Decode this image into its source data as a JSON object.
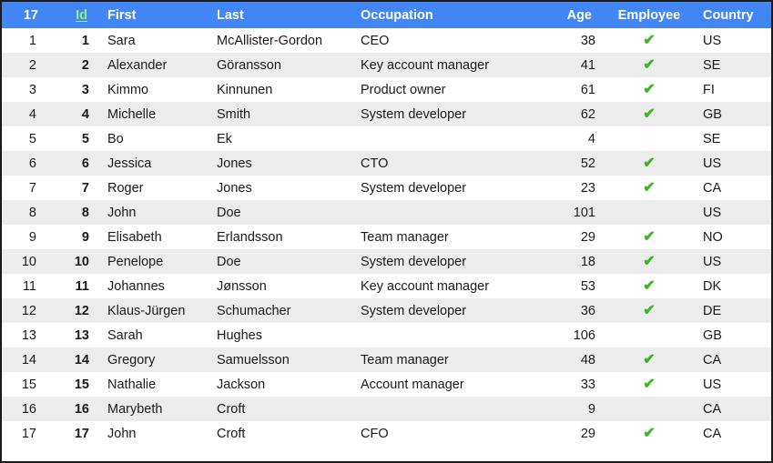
{
  "grid": {
    "row_count_label": "17",
    "sort_column": "Id",
    "accent_header_bg": "#4285f4",
    "sort_link_color": "#90ee7e",
    "check_color": "#3cb521",
    "alt_row_bg": "#ececec",
    "row_bg": "#ffffff",
    "columns": [
      {
        "key": "rownum",
        "label": "17",
        "name": "row-count-header",
        "sorted": false
      },
      {
        "key": "id",
        "label": "Id",
        "name": "column-header-id",
        "sorted": true
      },
      {
        "key": "first",
        "label": "First",
        "name": "column-header-first",
        "sorted": false
      },
      {
        "key": "last",
        "label": "Last",
        "name": "column-header-last",
        "sorted": false
      },
      {
        "key": "occupation",
        "label": "Occupation",
        "name": "column-header-occupation",
        "sorted": false
      },
      {
        "key": "age",
        "label": "Age",
        "name": "column-header-age",
        "sorted": false
      },
      {
        "key": "employee",
        "label": "Employee",
        "name": "column-header-employee",
        "sorted": false
      },
      {
        "key": "country",
        "label": "Country",
        "name": "column-header-country",
        "sorted": false
      }
    ],
    "check_glyph": "✔",
    "rows": [
      {
        "rownum": "1",
        "id": "1",
        "first": "Sara",
        "last": "McAllister-Gordon",
        "occupation": "CEO",
        "age": "38",
        "employee": true,
        "country": "US"
      },
      {
        "rownum": "2",
        "id": "2",
        "first": "Alexander",
        "last": "Göransson",
        "occupation": "Key account manager",
        "age": "41",
        "employee": true,
        "country": "SE"
      },
      {
        "rownum": "3",
        "id": "3",
        "first": "Kimmo",
        "last": "Kinnunen",
        "occupation": "Product owner",
        "age": "61",
        "employee": true,
        "country": "FI"
      },
      {
        "rownum": "4",
        "id": "4",
        "first": "Michelle",
        "last": "Smith",
        "occupation": "System developer",
        "age": "62",
        "employee": true,
        "country": "GB"
      },
      {
        "rownum": "5",
        "id": "5",
        "first": "Bo",
        "last": "Ek",
        "occupation": "",
        "age": "4",
        "employee": false,
        "country": "SE"
      },
      {
        "rownum": "6",
        "id": "6",
        "first": "Jessica",
        "last": "Jones",
        "occupation": "CTO",
        "age": "52",
        "employee": true,
        "country": "US"
      },
      {
        "rownum": "7",
        "id": "7",
        "first": "Roger",
        "last": "Jones",
        "occupation": "System developer",
        "age": "23",
        "employee": true,
        "country": "CA"
      },
      {
        "rownum": "8",
        "id": "8",
        "first": "John",
        "last": "Doe",
        "occupation": "",
        "age": "101",
        "employee": false,
        "country": "US"
      },
      {
        "rownum": "9",
        "id": "9",
        "first": "Elisabeth",
        "last": "Erlandsson",
        "occupation": "Team manager",
        "age": "29",
        "employee": true,
        "country": "NO"
      },
      {
        "rownum": "10",
        "id": "10",
        "first": "Penelope",
        "last": "Doe",
        "occupation": "System developer",
        "age": "18",
        "employee": true,
        "country": "US"
      },
      {
        "rownum": "11",
        "id": "11",
        "first": "Johannes",
        "last": "Jønsson",
        "occupation": "Key account manager",
        "age": "53",
        "employee": true,
        "country": "DK"
      },
      {
        "rownum": "12",
        "id": "12",
        "first": "Klaus-Jürgen",
        "last": "Schumacher",
        "occupation": "System developer",
        "age": "36",
        "employee": true,
        "country": "DE"
      },
      {
        "rownum": "13",
        "id": "13",
        "first": "Sarah",
        "last": "Hughes",
        "occupation": "",
        "age": "106",
        "employee": false,
        "country": "GB"
      },
      {
        "rownum": "14",
        "id": "14",
        "first": "Gregory",
        "last": "Samuelsson",
        "occupation": "Team manager",
        "age": "48",
        "employee": true,
        "country": "CA"
      },
      {
        "rownum": "15",
        "id": "15",
        "first": "Nathalie",
        "last": "Jackson",
        "occupation": "Account manager",
        "age": "33",
        "employee": true,
        "country": "US"
      },
      {
        "rownum": "16",
        "id": "16",
        "first": "Marybeth",
        "last": "Croft",
        "occupation": "",
        "age": "9",
        "employee": false,
        "country": "CA"
      },
      {
        "rownum": "17",
        "id": "17",
        "first": "John",
        "last": "Croft",
        "occupation": "CFO",
        "age": "29",
        "employee": true,
        "country": "CA"
      }
    ]
  }
}
